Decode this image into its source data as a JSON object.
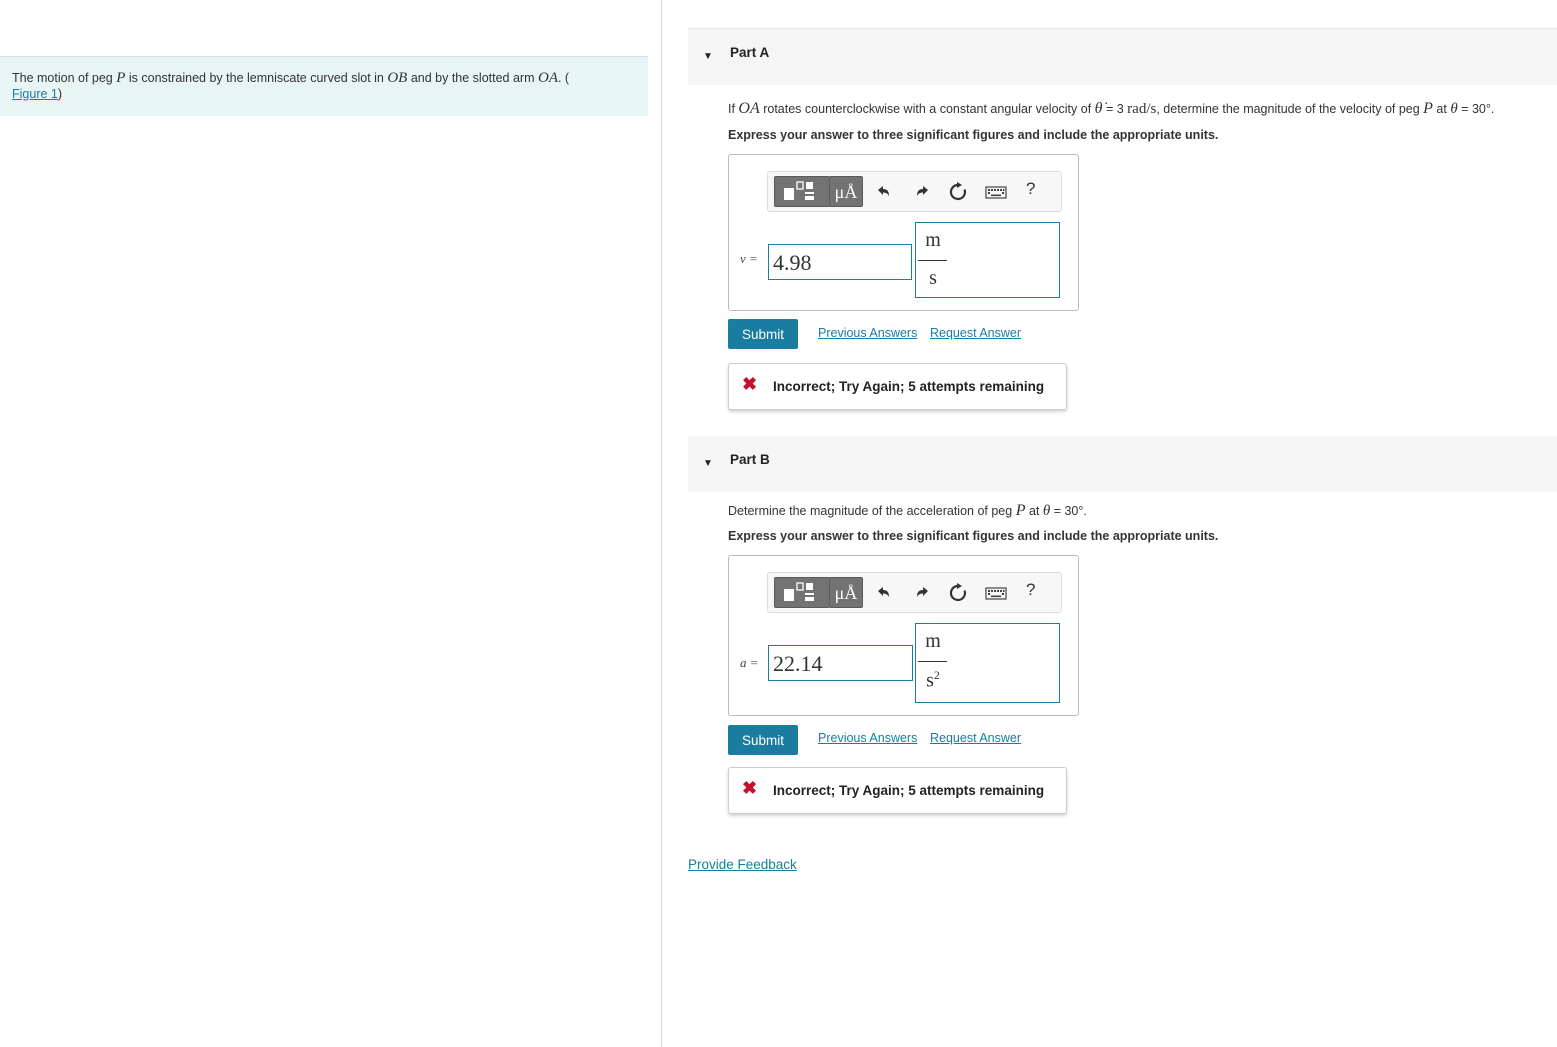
{
  "problem": {
    "text_before": "The motion of peg ",
    "var_p": "P",
    "text_mid1": " is constrained by the lemniscate curved slot in ",
    "var_ob": "OB",
    "text_mid2": " and by the slotted arm ",
    "var_oa": "OA",
    "text_end": ". (",
    "figure_link": "Figure 1",
    "close_paren": ")"
  },
  "part_a": {
    "title": "Part A",
    "question": {
      "t1": "If ",
      "oa": "OA",
      "t2": " rotates counterclockwise with a constant angular velocity of ",
      "theta_dot": "θ̇",
      "t3": " = 3 ",
      "unit": "rad/s",
      "t4": ", determine the magnitude of the velocity of peg ",
      "p": "P",
      "t5": " at ",
      "theta": "θ",
      "t6": " = 30°."
    },
    "instruction": "Express your answer to three significant figures and include the appropriate units.",
    "var_label": "v =",
    "value": "4.98",
    "unit_numerator": "m",
    "unit_denominator": "s",
    "submit_label": "Submit",
    "previous_answers": "Previous Answers",
    "request_answer": "Request Answer",
    "feedback": "Incorrect; Try Again; 5 attempts remaining"
  },
  "part_b": {
    "title": "Part B",
    "question": {
      "t1": "Determine the magnitude of the acceleration of peg ",
      "p": "P",
      "t2": " at ",
      "theta": "θ",
      "t3": " = 30°."
    },
    "instruction": "Express your answer to three significant figures and include the appropriate units.",
    "var_label": "a =",
    "value": "22.14",
    "unit_numerator": "m",
    "unit_denominator": "s",
    "unit_exponent": "2",
    "submit_label": "Submit",
    "previous_answers": "Previous Answers",
    "request_answer": "Request Answer",
    "feedback": "Incorrect; Try Again; 5 attempts remaining"
  },
  "toolbar": {
    "units_label": "μÅ",
    "help_label": "?"
  },
  "provide_feedback": "Provide Feedback",
  "colors": {
    "accent": "#1a7ca0",
    "error": "#c8102e",
    "problem_bg": "#e8f5f5"
  }
}
